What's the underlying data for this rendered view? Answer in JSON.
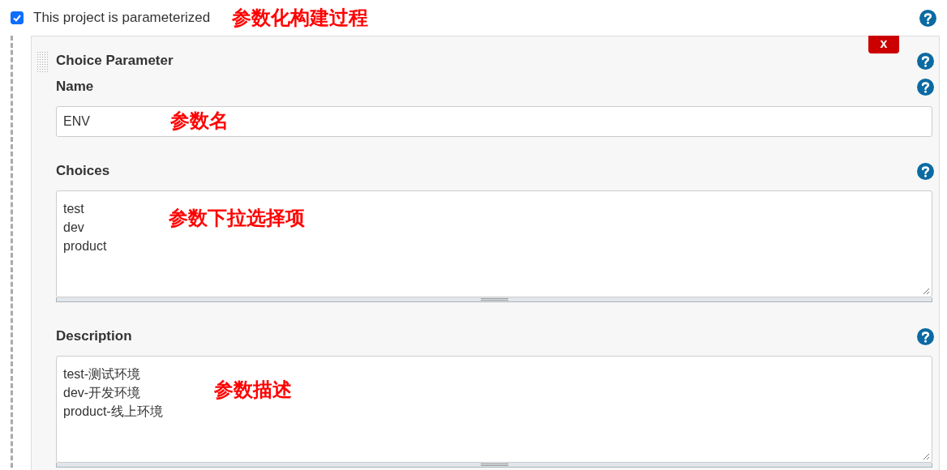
{
  "parameterized": {
    "label": "This project is parameterized",
    "checked": true,
    "annotation": "参数化构建过程"
  },
  "parameter": {
    "title": "Choice Parameter",
    "delete_label": "x",
    "fields": [
      {
        "kind": "input",
        "label": "Name",
        "value": "ENV",
        "annotation": "参数名"
      },
      {
        "kind": "textarea",
        "label": "Choices",
        "value": "test\ndev\nproduct",
        "annotation": "参数下拉选择项"
      },
      {
        "kind": "textarea",
        "label": "Description",
        "value": "test-测试环境\ndev-开发环境\nproduct-线上环境",
        "annotation": "参数描述"
      }
    ]
  }
}
